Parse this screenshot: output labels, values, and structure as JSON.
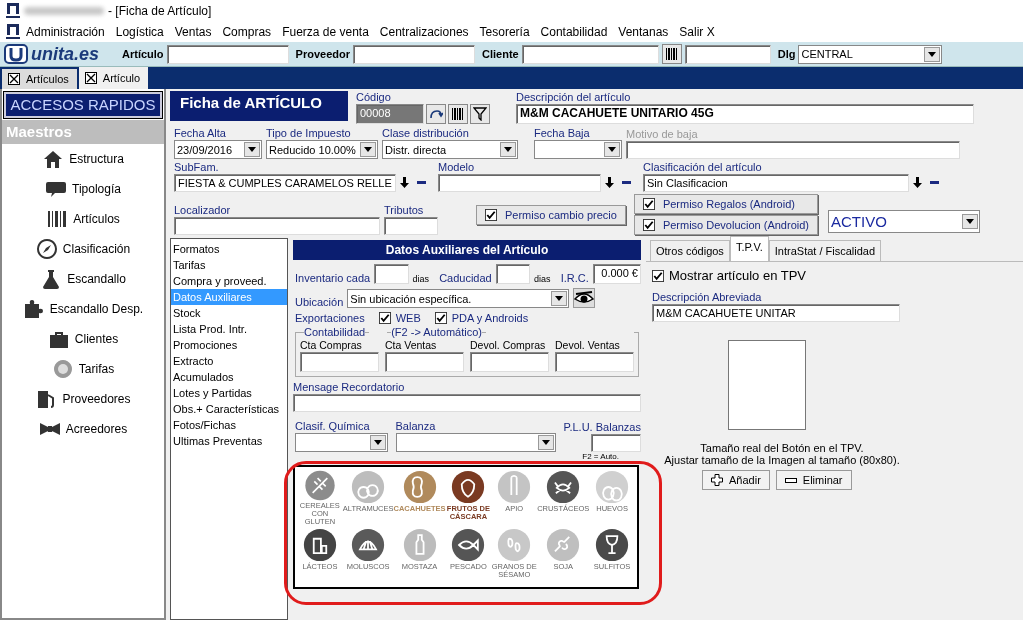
{
  "window": {
    "title": "- [Ficha de Artículo]"
  },
  "menu": [
    "Administración",
    "Logística",
    "Ventas",
    "Compras",
    "Fuerza de venta",
    "Centralizaciones",
    "Tesorería",
    "Contabilidad",
    "Ventanas",
    "Salir X"
  ],
  "toolbar": {
    "logo": "unita.es",
    "fields": [
      "Artículo",
      "Proveedor",
      "Cliente"
    ],
    "dlg": {
      "label": "Dlg",
      "value": "CENTRAL"
    }
  },
  "tabs": [
    {
      "label": "Artículos",
      "selected": false
    },
    {
      "label": "Artículo",
      "selected": true
    }
  ],
  "sidebar": {
    "title": "ACCESOS RAPIDOS",
    "section": "Maestros",
    "items": [
      {
        "label": "Estructura",
        "kind": "house"
      },
      {
        "label": "Tipología",
        "kind": "chat"
      },
      {
        "label": "Artículos",
        "kind": "barcode"
      },
      {
        "label": "Clasificación",
        "kind": "compass"
      },
      {
        "label": "Escandallo",
        "kind": "flask"
      },
      {
        "label": "Escandallo Desp.",
        "kind": "puzzle"
      },
      {
        "label": "Clientes",
        "kind": "briefcase"
      },
      {
        "label": "Tarifas",
        "kind": "coin"
      },
      {
        "label": "Proveedores",
        "kind": "pump"
      },
      {
        "label": "Acreedores",
        "kind": "bowtie"
      }
    ]
  },
  "form": {
    "title": "Ficha de ARTÍCULO",
    "codigo": {
      "label": "Código",
      "value": "00008"
    },
    "descripcion": {
      "label": "Descripción del artículo",
      "value": "M&M CACAHUETE UNITARIO 45G"
    },
    "fecha_alta": {
      "label": "Fecha Alta",
      "value": "23/09/2016"
    },
    "tipo_impuesto": {
      "label": "Tipo de Impuesto",
      "value": "Reducido 10.00%"
    },
    "clase_distribucion": {
      "label": "Clase distribución",
      "value": "Distr. directa"
    },
    "fecha_baja": {
      "label": "Fecha Baja"
    },
    "motivo_baja": {
      "label": "Motivo de baja",
      "disabled": true
    },
    "subfam": {
      "label": "SubFam.",
      "value": "FIESTA & CUMPLES CARAMELOS RELLE"
    },
    "modelo": {
      "label": "Modelo"
    },
    "clasificacion": {
      "label": "Clasificación del artículo",
      "value": "Sin Clasificacion"
    },
    "localizador": {
      "label": "Localizador"
    },
    "tributos": {
      "label": "Tributos"
    },
    "permisos": [
      {
        "label": "Permiso cambio precio",
        "checked": true
      },
      {
        "label": "Permiso Regalos (Android)",
        "checked": true
      },
      {
        "label": "Permiso Devolucion (Android)",
        "checked": true
      }
    ],
    "estado": "ACTIVO"
  },
  "nav": [
    {
      "label": "Formatos",
      "selected": false
    },
    {
      "label": "Tarifas",
      "selected": false
    },
    {
      "label": "Compra y proveed.",
      "selected": false
    },
    {
      "label": "Datos Auxiliares",
      "selected": true
    },
    {
      "label": "Stock",
      "selected": false
    },
    {
      "label": "Lista Prod. Intr.",
      "selected": false
    },
    {
      "label": "Promociones",
      "selected": false
    },
    {
      "label": "Extracto",
      "selected": false
    },
    {
      "label": "Acumulados",
      "selected": false
    },
    {
      "label": "Lotes y Partidas",
      "selected": false
    },
    {
      "label": "Obs.+ Características",
      "selected": false
    },
    {
      "label": "Fotos/Fichas",
      "selected": false
    },
    {
      "label": "Ultimas Preventas",
      "selected": false
    }
  ],
  "aux": {
    "title": "Datos Auxiliares del Artículo",
    "inventario": {
      "label": "Inventario cada",
      "unit": "dias"
    },
    "caducidad": {
      "label": "Caducidad",
      "unit": "dias"
    },
    "irc": {
      "label": "I.R.C.",
      "value": "0.000 €"
    },
    "ubicacion": {
      "label": "Ubicación",
      "value": "Sin ubicación específica."
    },
    "exportaciones": {
      "label": "Exportaciones",
      "options": [
        {
          "label": "WEB",
          "checked": true
        },
        {
          "label": "PDA y Androids",
          "checked": true
        }
      ]
    },
    "contabilidad": {
      "legend": "Contabilidad",
      "hint": "(F2 -> Automático)",
      "fields": [
        "Cta Compras",
        "Cta Ventas",
        "Devol. Compras",
        "Devol. Ventas"
      ]
    },
    "mensaje": {
      "label": "Mensage Recordatorio"
    },
    "clasif_quimica": {
      "label": "Clasif. Química"
    },
    "balanza": {
      "label": "Balanza"
    },
    "plu": {
      "label": "P.L.U. Balanzas",
      "note": "F2 = Auto."
    },
    "allergens": [
      {
        "label": "CEREALES CON GLUTEN",
        "kind": "wheat",
        "selected": false,
        "color": "#8c8c8c"
      },
      {
        "label": "ALTRAMUCES",
        "kind": "lupin",
        "selected": false,
        "color": "#bdbdbd"
      },
      {
        "label": "CACAHUETES",
        "kind": "peanut",
        "selected": true,
        "color": "#b08a5c"
      },
      {
        "label": "FRUTOS DE CÁSCARA",
        "kind": "nut",
        "selected": true,
        "color": "#7a3a22"
      },
      {
        "label": "APIO",
        "kind": "celery",
        "selected": false,
        "color": "#c4c4c4"
      },
      {
        "label": "CRUSTÁCEOS",
        "kind": "crab",
        "selected": false,
        "color": "#555555"
      },
      {
        "label": "HUEVOS",
        "kind": "egg",
        "selected": false,
        "color": "#d0d0d0"
      },
      {
        "label": "LÁCTEOS",
        "kind": "milk",
        "selected": false,
        "color": "#444444"
      },
      {
        "label": "MOLUSCOS",
        "kind": "shell",
        "selected": false,
        "color": "#5a5a5a"
      },
      {
        "label": "MOSTAZA",
        "kind": "bottle",
        "selected": false,
        "color": "#bcbcbc"
      },
      {
        "label": "PESCADO",
        "kind": "fish",
        "selected": false,
        "color": "#555555"
      },
      {
        "label": "GRANOS DE SÉSAMO",
        "kind": "seeds",
        "selected": false,
        "color": "#c8c8c8"
      },
      {
        "label": "SOJA",
        "kind": "chain",
        "selected": false,
        "color": "#bfbfbf"
      },
      {
        "label": "SULFITOS",
        "kind": "glass",
        "selected": false,
        "color": "#4a4a4a"
      }
    ]
  },
  "tpv": {
    "tabs": [
      {
        "label": "Otros códigos",
        "selected": false
      },
      {
        "label": "T.P.V.",
        "selected": true
      },
      {
        "label": "IntraStat / Fiscalidad",
        "selected": false
      }
    ],
    "mostrar": {
      "label": "Mostrar artículo en TPV",
      "checked": true
    },
    "descripcion": {
      "label": "Descripción Abreviada",
      "value": "M&M CACAHUETE UNITAR"
    },
    "note": [
      "Tamaño real del Botón en el TPV.",
      "Ajustar tamaño de la Imagen al tamaño (80x80)."
    ],
    "buttons": [
      {
        "label": "Añadir",
        "kind": "add"
      },
      {
        "label": "Eliminar",
        "kind": "remove"
      }
    ]
  }
}
